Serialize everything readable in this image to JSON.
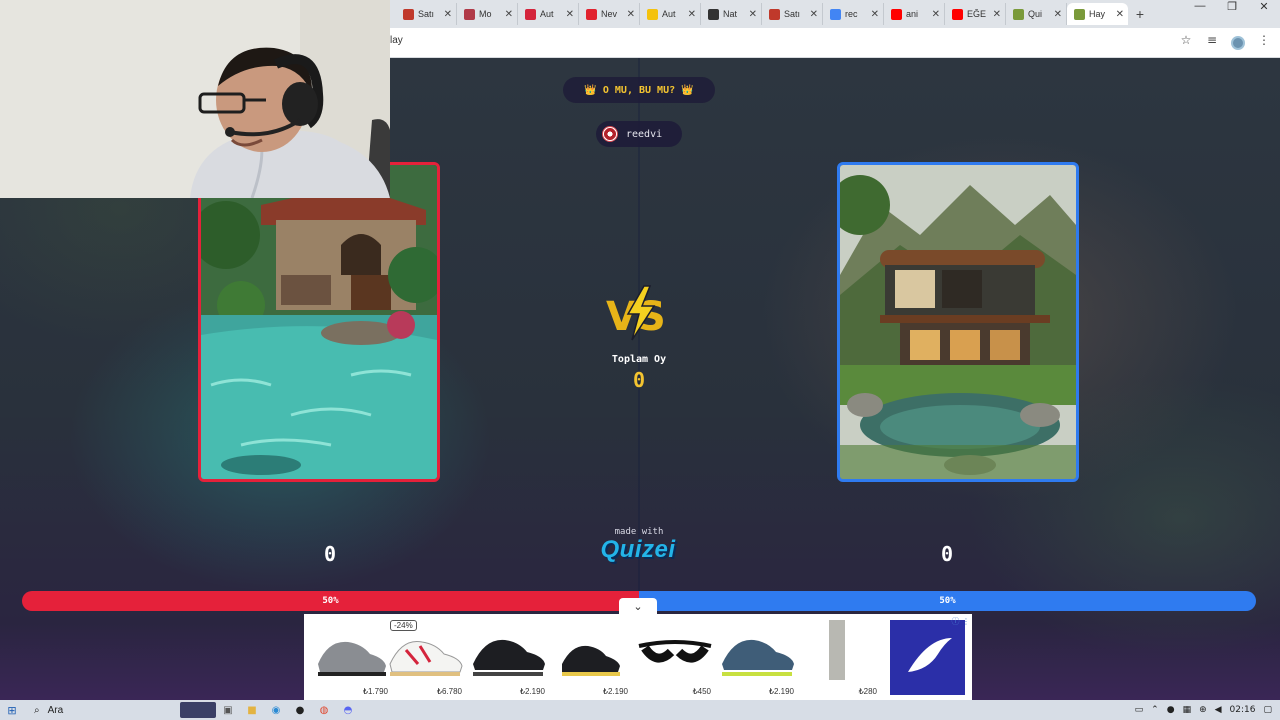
{
  "browser": {
    "tabs": [
      {
        "label": "Satı",
        "color": "#c0392b"
      },
      {
        "label": "Mo",
        "color": "#b03a48"
      },
      {
        "label": "Aut",
        "color": "#d4243c"
      },
      {
        "label": "Nev",
        "color": "#e1222e"
      },
      {
        "label": "Aut",
        "color": "#f4c20d"
      },
      {
        "label": "Nat",
        "color": "#333333"
      },
      {
        "label": "Satı",
        "color": "#c0392b"
      },
      {
        "label": "rec",
        "color": "#4285f4"
      },
      {
        "label": "ani",
        "color": "#ff0000"
      },
      {
        "label": "EĞE",
        "color": "#ff0000"
      },
      {
        "label": "Qui",
        "color": "#7a9a3a"
      },
      {
        "label": "Hay",
        "color": "#7a9a3a"
      }
    ],
    "new_tab": "+",
    "url": "lay",
    "window_controls": [
      "—",
      "❐",
      "✕"
    ]
  },
  "game": {
    "title": "👑 O MU, BU MU? 👑",
    "username": "reedvi",
    "vs_label": "VS",
    "total_label": "Toplam Oy",
    "total_value": "0",
    "left_score": "0",
    "right_score": "0",
    "made_with": "made with",
    "brand": "Quizei",
    "left_percent_label": "50%",
    "right_percent_label": "50%",
    "left_share": 0.5,
    "right_share": 0.5,
    "colors": {
      "left": "#e5213a",
      "right": "#2f7bf0",
      "accent": "#f4c430"
    }
  },
  "ad": {
    "discount": "-24%",
    "products": [
      {
        "price": "₺1.790"
      },
      {
        "price": "₺6.780"
      },
      {
        "price": "₺2.190"
      },
      {
        "price": "₺2.190"
      },
      {
        "price": "₺450"
      },
      {
        "price": "₺2.190"
      },
      {
        "price": "₺280"
      }
    ],
    "collapse_icon": "chevron-down-icon"
  },
  "taskbar": {
    "search_label": "Ara",
    "clock": "02:16"
  }
}
